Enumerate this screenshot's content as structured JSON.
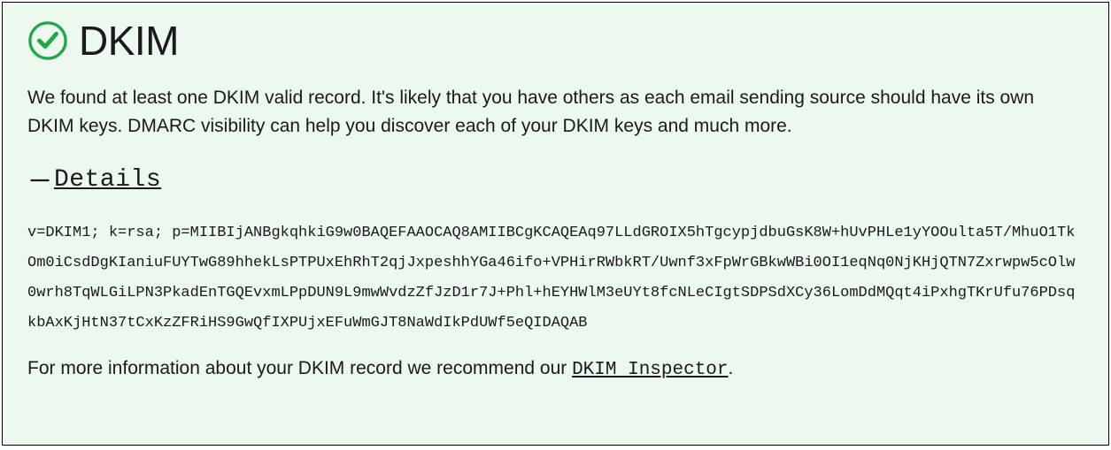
{
  "header": {
    "title": "DKIM"
  },
  "description": "We found at least one DKIM valid record. It's likely that you have others as each email sending source should have its own DKIM keys. DMARC visibility can help you discover each of your DKIM keys and much more.",
  "details": {
    "toggle_label": " Details",
    "record": "v=DKIM1; k=rsa; p=MIIBIjANBgkqhkiG9w0BAQEFAAOCAQ8AMIIBCgKCAQEAq97LLdGROIX5hTgcypjdbuGsK8W+hUvPHLe1yYOOulta5T/MhuO1TkOm0iCsdDgKIaniuFUYTwG89hhekLsPTPUxEhRhT2qjJxpeshhYGa46ifo+VPHirRWbkRT/Uwnf3xFpWrGBkwWBi0OI1eqNq0NjKHjQTN7Zxrwpw5cOlw0wrh8TqWLGiLPN3PkadEnTGQEvxmLPpDUN9L9mwWvdzZfJzD1r7J+Phl+hEYHWlM3eUYt8fcNLeCIgtSDPSdXCy36LomDdMQqt4iPxhgTKrUfu76PDsqkbAxKjHtN37tCxKzZFRiHS9GwQfIXPUjxEFuWmGJT8NaWdIkPdUWf5eQIDAQAB"
  },
  "footer": {
    "text_prefix": "For more information about your DKIM record we recommend our ",
    "link_label": "DKIM Inspector",
    "text_suffix": "."
  }
}
